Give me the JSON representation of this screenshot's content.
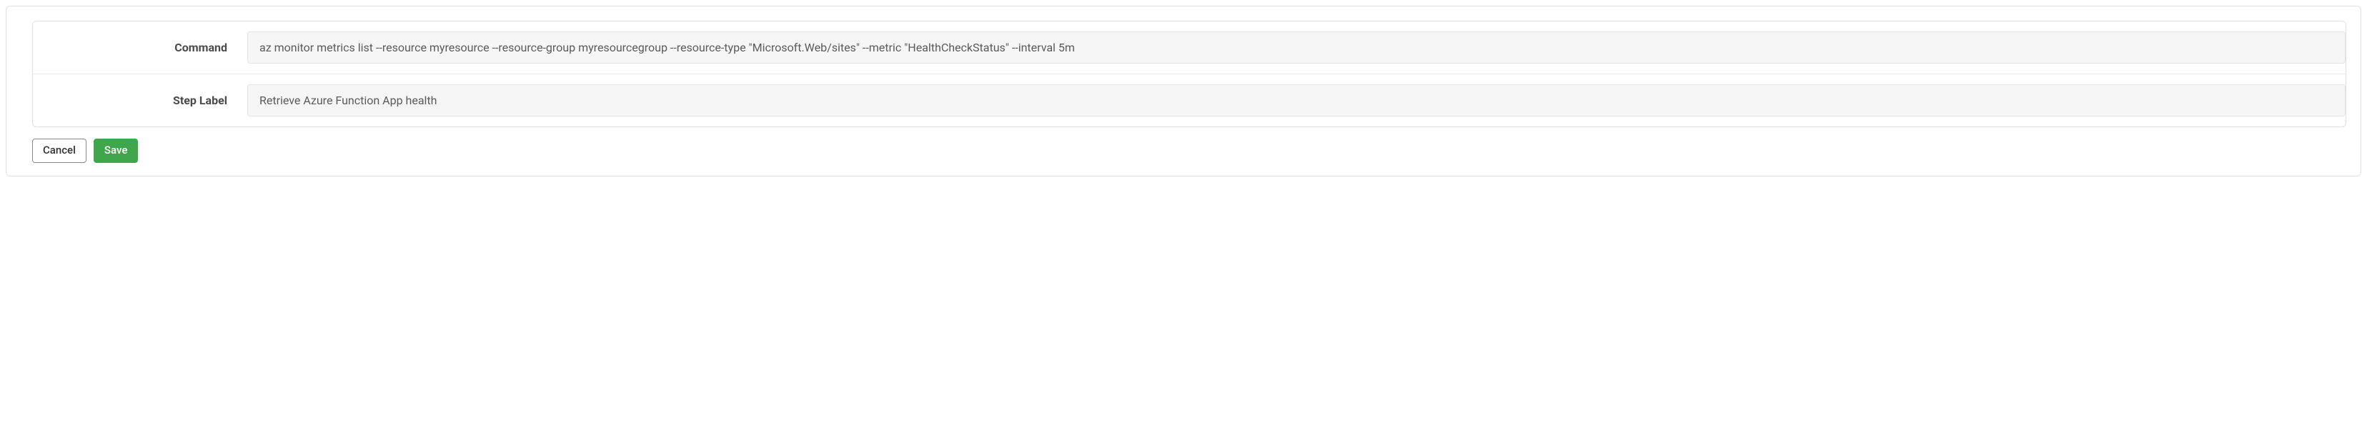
{
  "form": {
    "rows": [
      {
        "label": "Command",
        "value": "az monitor metrics list --resource myresource --resource-group myresourcegroup --resource-type \"Microsoft.Web/sites\" --metric \"HealthCheckStatus\" --interval 5m"
      },
      {
        "label": "Step Label",
        "value": "Retrieve Azure Function App health"
      }
    ]
  },
  "buttons": {
    "cancel": "Cancel",
    "save": "Save"
  }
}
